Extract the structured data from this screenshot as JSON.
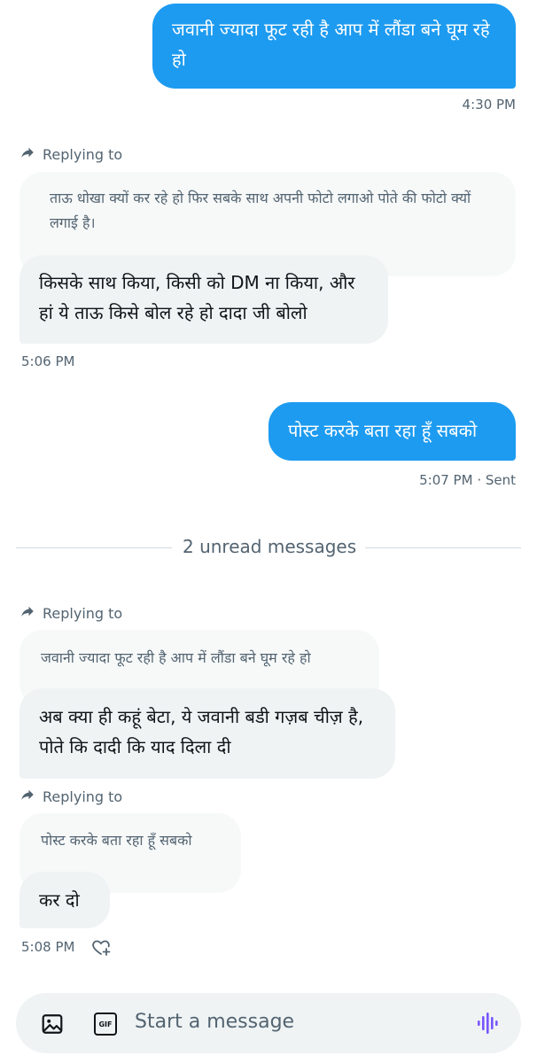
{
  "messages": {
    "sent1": {
      "text": "जवानी ज्यादा फूट रही है आप में लौंडा बने घूम रहे हो",
      "time": "4:30 PM"
    },
    "reply1": {
      "replying_label": "Replying to",
      "quote": "ताऊ धोखा क्यों कर रहे हो फिर सबके साथ अपनी फोटो लगाओ पोते की फोटो क्यों लगाई है।",
      "text": "किसके साथ किया, किसी को DM ना किया, और हां ये ताऊ किसे बोल रहे हो दादा जी बोलो",
      "time": "5:06 PM"
    },
    "sent2": {
      "text": "पोस्ट करके बता रहा हूँ सबको",
      "time": "5:07 PM · Sent"
    },
    "divider": "2 unread messages",
    "reply2": {
      "replying_label": "Replying to",
      "quote": "जवानी ज्यादा फूट रही है आप में लौंडा बने घूम रहे हो",
      "text": "अब क्या ही कहूं बेटा, ये जवानी बडी गज़ब चीज़ है, पोते कि दादी कि याद दिला दी"
    },
    "reply3": {
      "replying_label": "Replying to",
      "quote": "पोस्ट करके बता रहा हूँ सबको",
      "text": "कर दो",
      "time": "5:08 PM"
    }
  },
  "composer": {
    "placeholder": "Start a message",
    "gif_label": "GIF"
  },
  "colors": {
    "accent": "#1d9bf0",
    "voice": "#7856ff",
    "received_bubble": "#eff3f4"
  }
}
